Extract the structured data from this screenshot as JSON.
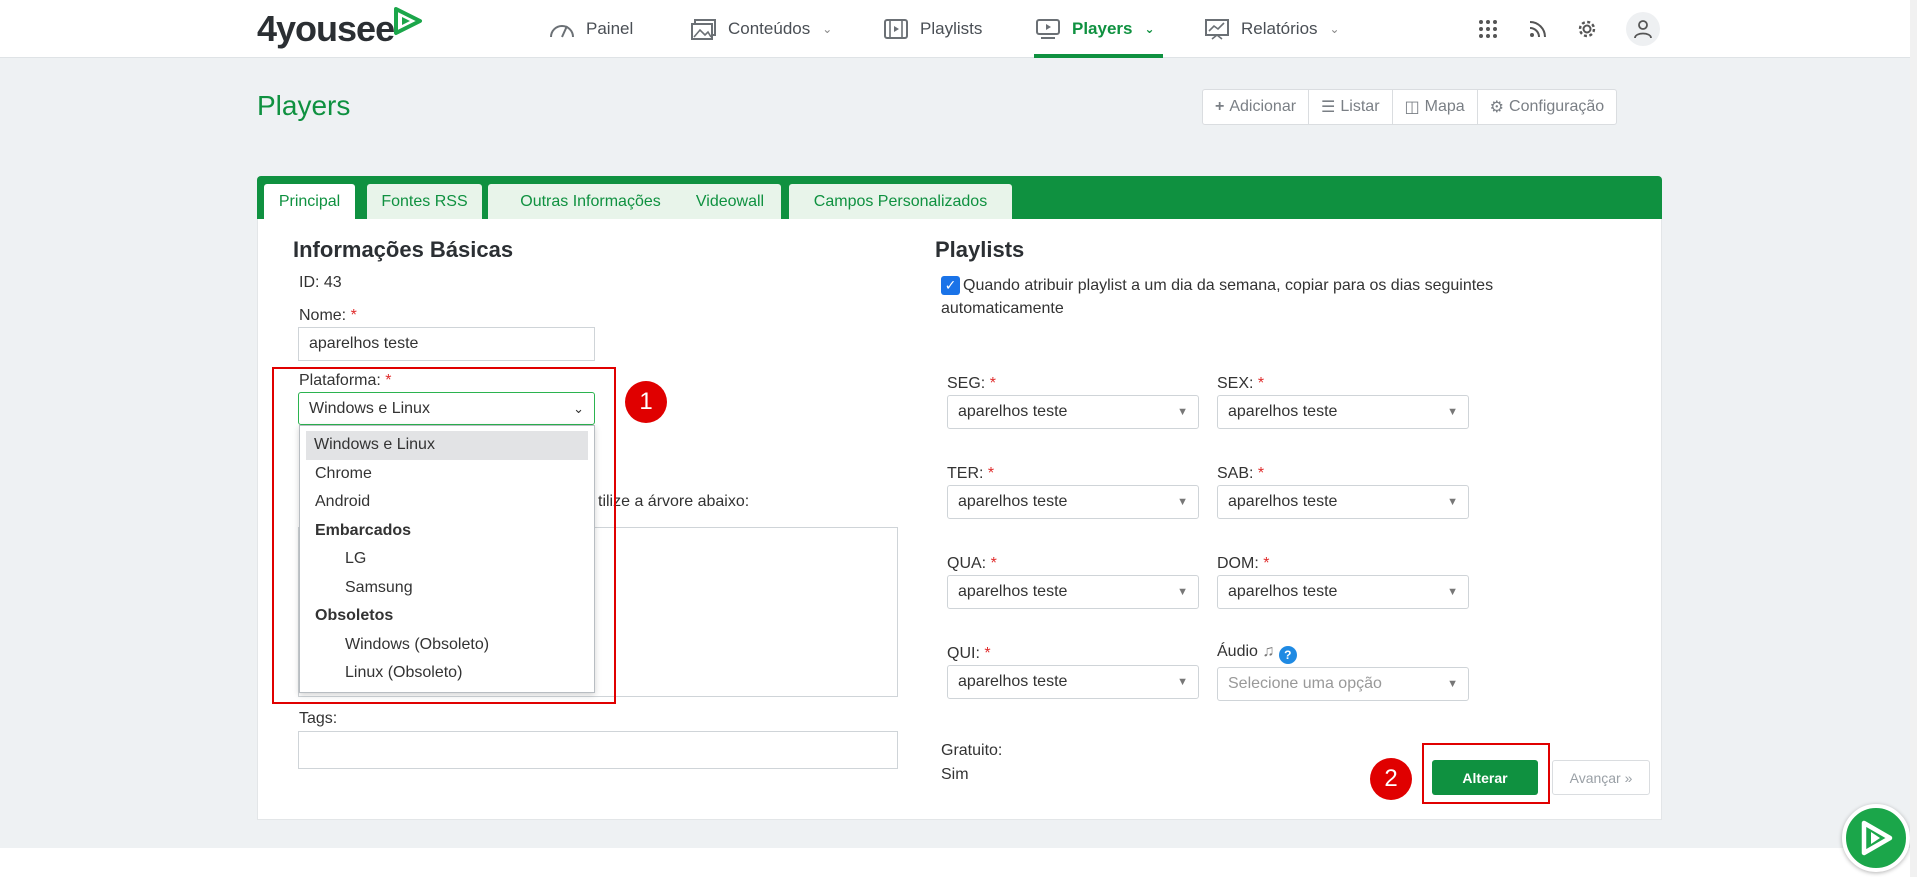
{
  "brand": {
    "name": "4yousee",
    "color": "#0f9140"
  },
  "nav": {
    "items": [
      {
        "label": "Painel",
        "icon": "gauge-icon",
        "dropdown": false
      },
      {
        "label": "Conteúdos",
        "icon": "images-icon",
        "dropdown": true
      },
      {
        "label": "Playlists",
        "icon": "playlist-icon",
        "dropdown": false
      },
      {
        "label": "Players",
        "icon": "player-icon",
        "dropdown": true,
        "active": true
      },
      {
        "label": "Relatórios",
        "icon": "report-icon",
        "dropdown": true
      }
    ],
    "right_icons": [
      "apps-grid-icon",
      "rss-icon",
      "gear-icon",
      "user-icon"
    ]
  },
  "page": {
    "title": "Players"
  },
  "actions": [
    {
      "label": "Adicionar",
      "icon": "plus-icon"
    },
    {
      "label": "Listar",
      "icon": "list-icon"
    },
    {
      "label": "Mapa",
      "icon": "map-icon"
    },
    {
      "label": "Configuração",
      "icon": "gear-icon"
    }
  ],
  "tabs": [
    {
      "label": "Principal",
      "active": true
    },
    {
      "label": "Fontes RSS"
    },
    {
      "label": "Outras Informações"
    },
    {
      "label": "Videowall"
    },
    {
      "label": "Campos Personalizados"
    }
  ],
  "basic_info": {
    "heading": "Informações Básicas",
    "id_text": "ID: 43",
    "name_label": "Nome:",
    "name_value": "aparelhos teste",
    "platform_label": "Plataforma:",
    "platform_value": "Windows e Linux",
    "platform_options": [
      {
        "label": "Windows e Linux",
        "level": 0,
        "selected": true
      },
      {
        "label": "Chrome",
        "level": 0
      },
      {
        "label": "Android",
        "level": 0
      },
      {
        "label": "Embarcados",
        "group": true
      },
      {
        "label": "LG",
        "level": 1
      },
      {
        "label": "Samsung",
        "level": 1
      },
      {
        "label": "Obsoletos",
        "group": true
      },
      {
        "label": "Windows (Obsoleto)",
        "level": 1
      },
      {
        "label": "Linux (Obsoleto)",
        "level": 1
      }
    ],
    "tree_hint": "tilize a árvore abaixo:",
    "tags_label": "Tags:",
    "required_mark": "*"
  },
  "playlists": {
    "heading": "Playlists",
    "copy_checkbox_label": "Quando atribuir playlist a um dia da semana, copiar para os dias seguintes automaticamente",
    "copy_checkbox_checked": true,
    "days": [
      {
        "label": "SEG:",
        "value": "aparelhos teste"
      },
      {
        "label": "SEX:",
        "value": "aparelhos teste"
      },
      {
        "label": "TER:",
        "value": "aparelhos teste"
      },
      {
        "label": "SAB:",
        "value": "aparelhos teste"
      },
      {
        "label": "QUA:",
        "value": "aparelhos teste"
      },
      {
        "label": "DOM:",
        "value": "aparelhos teste"
      },
      {
        "label": "QUI:",
        "value": "aparelhos teste"
      }
    ],
    "audio_label": "Áudio",
    "audio_placeholder": "Selecione uma opção",
    "free_label": "Gratuito:",
    "free_value": "Sim"
  },
  "buttons": {
    "alterar": "Alterar",
    "avancar": "Avançar »"
  },
  "annotations": {
    "one": "1",
    "two": "2"
  }
}
